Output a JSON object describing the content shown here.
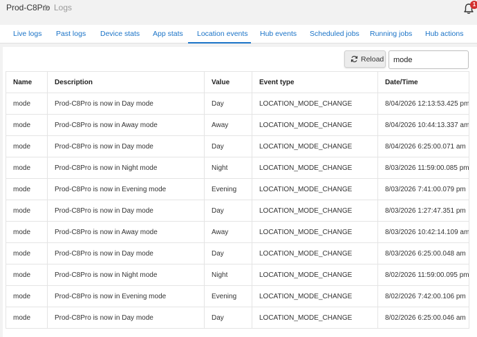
{
  "breadcrumb": {
    "home": "Prod-C8Pro",
    "current": "Logs"
  },
  "notifications": {
    "count": "1",
    "badge_color": "#d32f2f"
  },
  "tabs": [
    {
      "label": "Live logs"
    },
    {
      "label": "Past logs"
    },
    {
      "label": "Device stats"
    },
    {
      "label": "App stats"
    },
    {
      "label": "Location events",
      "active": true
    },
    {
      "label": "Hub events"
    },
    {
      "label": "Scheduled jobs"
    },
    {
      "label": "Running jobs"
    },
    {
      "label": "Hub actions"
    }
  ],
  "toolbar": {
    "reload_label": "Reload",
    "search_value": "mode"
  },
  "colors": {
    "accent": "#1a73c7",
    "badge": "#d32f2f"
  },
  "table": {
    "headers": [
      "Name",
      "Description",
      "Value",
      "Event type",
      "Date/Time"
    ],
    "rows": [
      [
        "mode",
        "Prod-C8Pro is now in Day mode",
        "Day",
        "LOCATION_MODE_CHANGE",
        "8/04/2026 12:13:53.425 pm"
      ],
      [
        "mode",
        "Prod-C8Pro is now in Away mode",
        "Away",
        "LOCATION_MODE_CHANGE",
        "8/04/2026 10:44:13.337 am"
      ],
      [
        "mode",
        "Prod-C8Pro is now in Day mode",
        "Day",
        "LOCATION_MODE_CHANGE",
        "8/04/2026 6:25:00.071 am"
      ],
      [
        "mode",
        "Prod-C8Pro is now in Night mode",
        "Night",
        "LOCATION_MODE_CHANGE",
        "8/03/2026 11:59:00.085 pm"
      ],
      [
        "mode",
        "Prod-C8Pro is now in Evening mode",
        "Evening",
        "LOCATION_MODE_CHANGE",
        "8/03/2026 7:41:00.079 pm"
      ],
      [
        "mode",
        "Prod-C8Pro is now in Day mode",
        "Day",
        "LOCATION_MODE_CHANGE",
        "8/03/2026 1:27:47.351 pm"
      ],
      [
        "mode",
        "Prod-C8Pro is now in Away mode",
        "Away",
        "LOCATION_MODE_CHANGE",
        "8/03/2026 10:42:14.109 am"
      ],
      [
        "mode",
        "Prod-C8Pro is now in Day mode",
        "Day",
        "LOCATION_MODE_CHANGE",
        "8/03/2026 6:25:00.048 am"
      ],
      [
        "mode",
        "Prod-C8Pro is now in Night mode",
        "Night",
        "LOCATION_MODE_CHANGE",
        "8/02/2026 11:59:00.095 pm"
      ],
      [
        "mode",
        "Prod-C8Pro is now in Evening mode",
        "Evening",
        "LOCATION_MODE_CHANGE",
        "8/02/2026 7:42:00.106 pm"
      ],
      [
        "mode",
        "Prod-C8Pro is now in Day mode",
        "Day",
        "LOCATION_MODE_CHANGE",
        "8/02/2026 6:25:00.046 am"
      ]
    ]
  }
}
